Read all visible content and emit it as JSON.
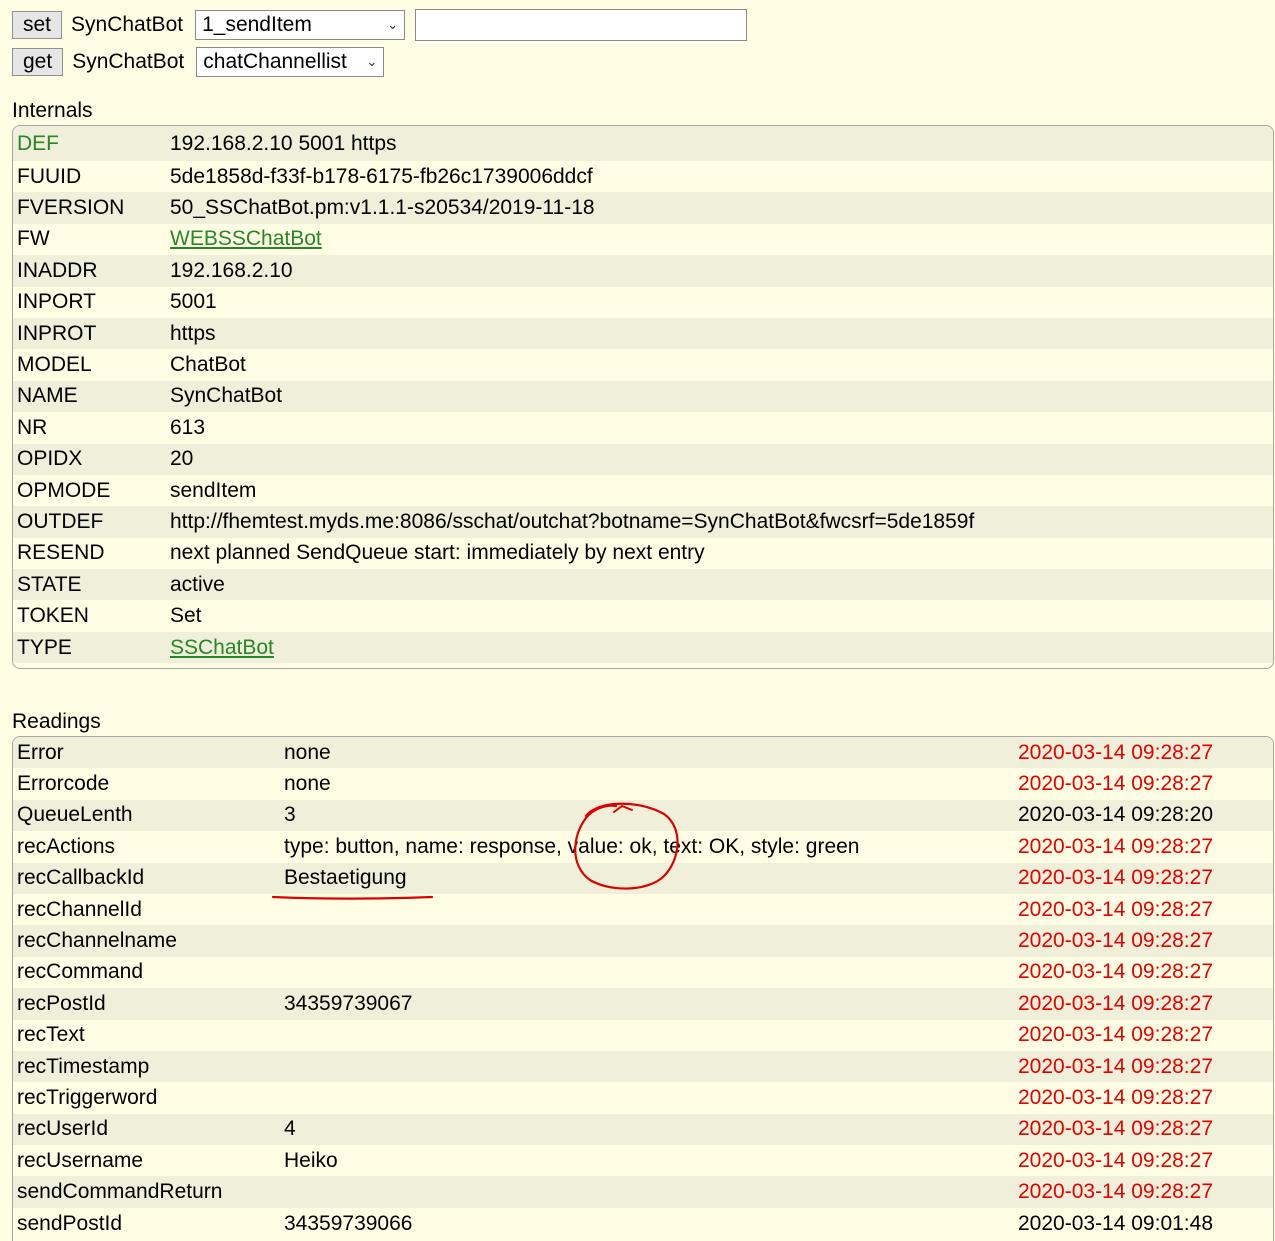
{
  "set_row": {
    "button": "set",
    "device": "SynChatBot",
    "selected": "1_sendItem",
    "input_value": ""
  },
  "get_row": {
    "button": "get",
    "device": "SynChatBot",
    "selected": "chatChannellist"
  },
  "internals": {
    "title": "Internals",
    "rows": [
      {
        "key": "DEF",
        "value": "192.168.2.10 5001 https"
      },
      {
        "key": "FUUID",
        "value": "5de1858d-f33f-b178-6175-fb26c1739006ddcf"
      },
      {
        "key": "FVERSION",
        "value": "50_SSChatBot.pm:v1.1.1-s20534/2019-11-18"
      },
      {
        "key": "FW",
        "value": "WEBSSChatBot"
      },
      {
        "key": "INADDR",
        "value": "192.168.2.10"
      },
      {
        "key": "INPORT",
        "value": "5001"
      },
      {
        "key": "INPROT",
        "value": "https"
      },
      {
        "key": "MODEL",
        "value": "ChatBot"
      },
      {
        "key": "NAME",
        "value": "SynChatBot"
      },
      {
        "key": "NR",
        "value": "613"
      },
      {
        "key": "OPIDX",
        "value": "20"
      },
      {
        "key": "OPMODE",
        "value": "sendItem"
      },
      {
        "key": "OUTDEF",
        "value": "http://fhemtest.myds.me:8086/sschat/outchat?botname=SynChatBot&fwcsrf=5de1859f"
      },
      {
        "key": "RESEND",
        "value": "next planned SendQueue start: immediately by next entry"
      },
      {
        "key": "STATE",
        "value": "active"
      },
      {
        "key": "TOKEN",
        "value": "Set"
      },
      {
        "key": "TYPE",
        "value": "SSChatBot"
      }
    ]
  },
  "readings": {
    "title": "Readings",
    "rows": [
      {
        "key": "Error",
        "value": "none",
        "time": "2020-03-14 09:28:27"
      },
      {
        "key": "Errorcode",
        "value": "none",
        "time": "2020-03-14 09:28:27"
      },
      {
        "key": "QueueLenth",
        "value": "3",
        "time": "2020-03-14 09:28:20"
      },
      {
        "key": "recActions",
        "value": "type: button, name: response, value: ok, text: OK, style: green",
        "time": "2020-03-14 09:28:27"
      },
      {
        "key": "recCallbackId",
        "value": "Bestaetigung",
        "time": "2020-03-14 09:28:27"
      },
      {
        "key": "recChannelId",
        "value": "",
        "time": "2020-03-14 09:28:27"
      },
      {
        "key": "recChannelname",
        "value": "",
        "time": "2020-03-14 09:28:27"
      },
      {
        "key": "recCommand",
        "value": "",
        "time": "2020-03-14 09:28:27"
      },
      {
        "key": "recPostId",
        "value": "34359739067",
        "time": "2020-03-14 09:28:27"
      },
      {
        "key": "recText",
        "value": "",
        "time": "2020-03-14 09:28:27"
      },
      {
        "key": "recTimestamp",
        "value": "",
        "time": "2020-03-14 09:28:27"
      },
      {
        "key": "recTriggerword",
        "value": "",
        "time": "2020-03-14 09:28:27"
      },
      {
        "key": "recUserId",
        "value": "4",
        "time": "2020-03-14 09:28:27"
      },
      {
        "key": "recUsername",
        "value": "Heiko",
        "time": "2020-03-14 09:28:27"
      },
      {
        "key": "sendCommandReturn",
        "value": "",
        "time": "2020-03-14 09:28:27"
      },
      {
        "key": "sendPostId",
        "value": "34359739066",
        "time": "2020-03-14 09:01:48"
      }
    ]
  },
  "colors": {
    "background": "#fffee4",
    "row_alt": "#f0efd9",
    "link_green": "#278727",
    "recent_red": "#e60000",
    "annotation_red": "#e00000"
  }
}
